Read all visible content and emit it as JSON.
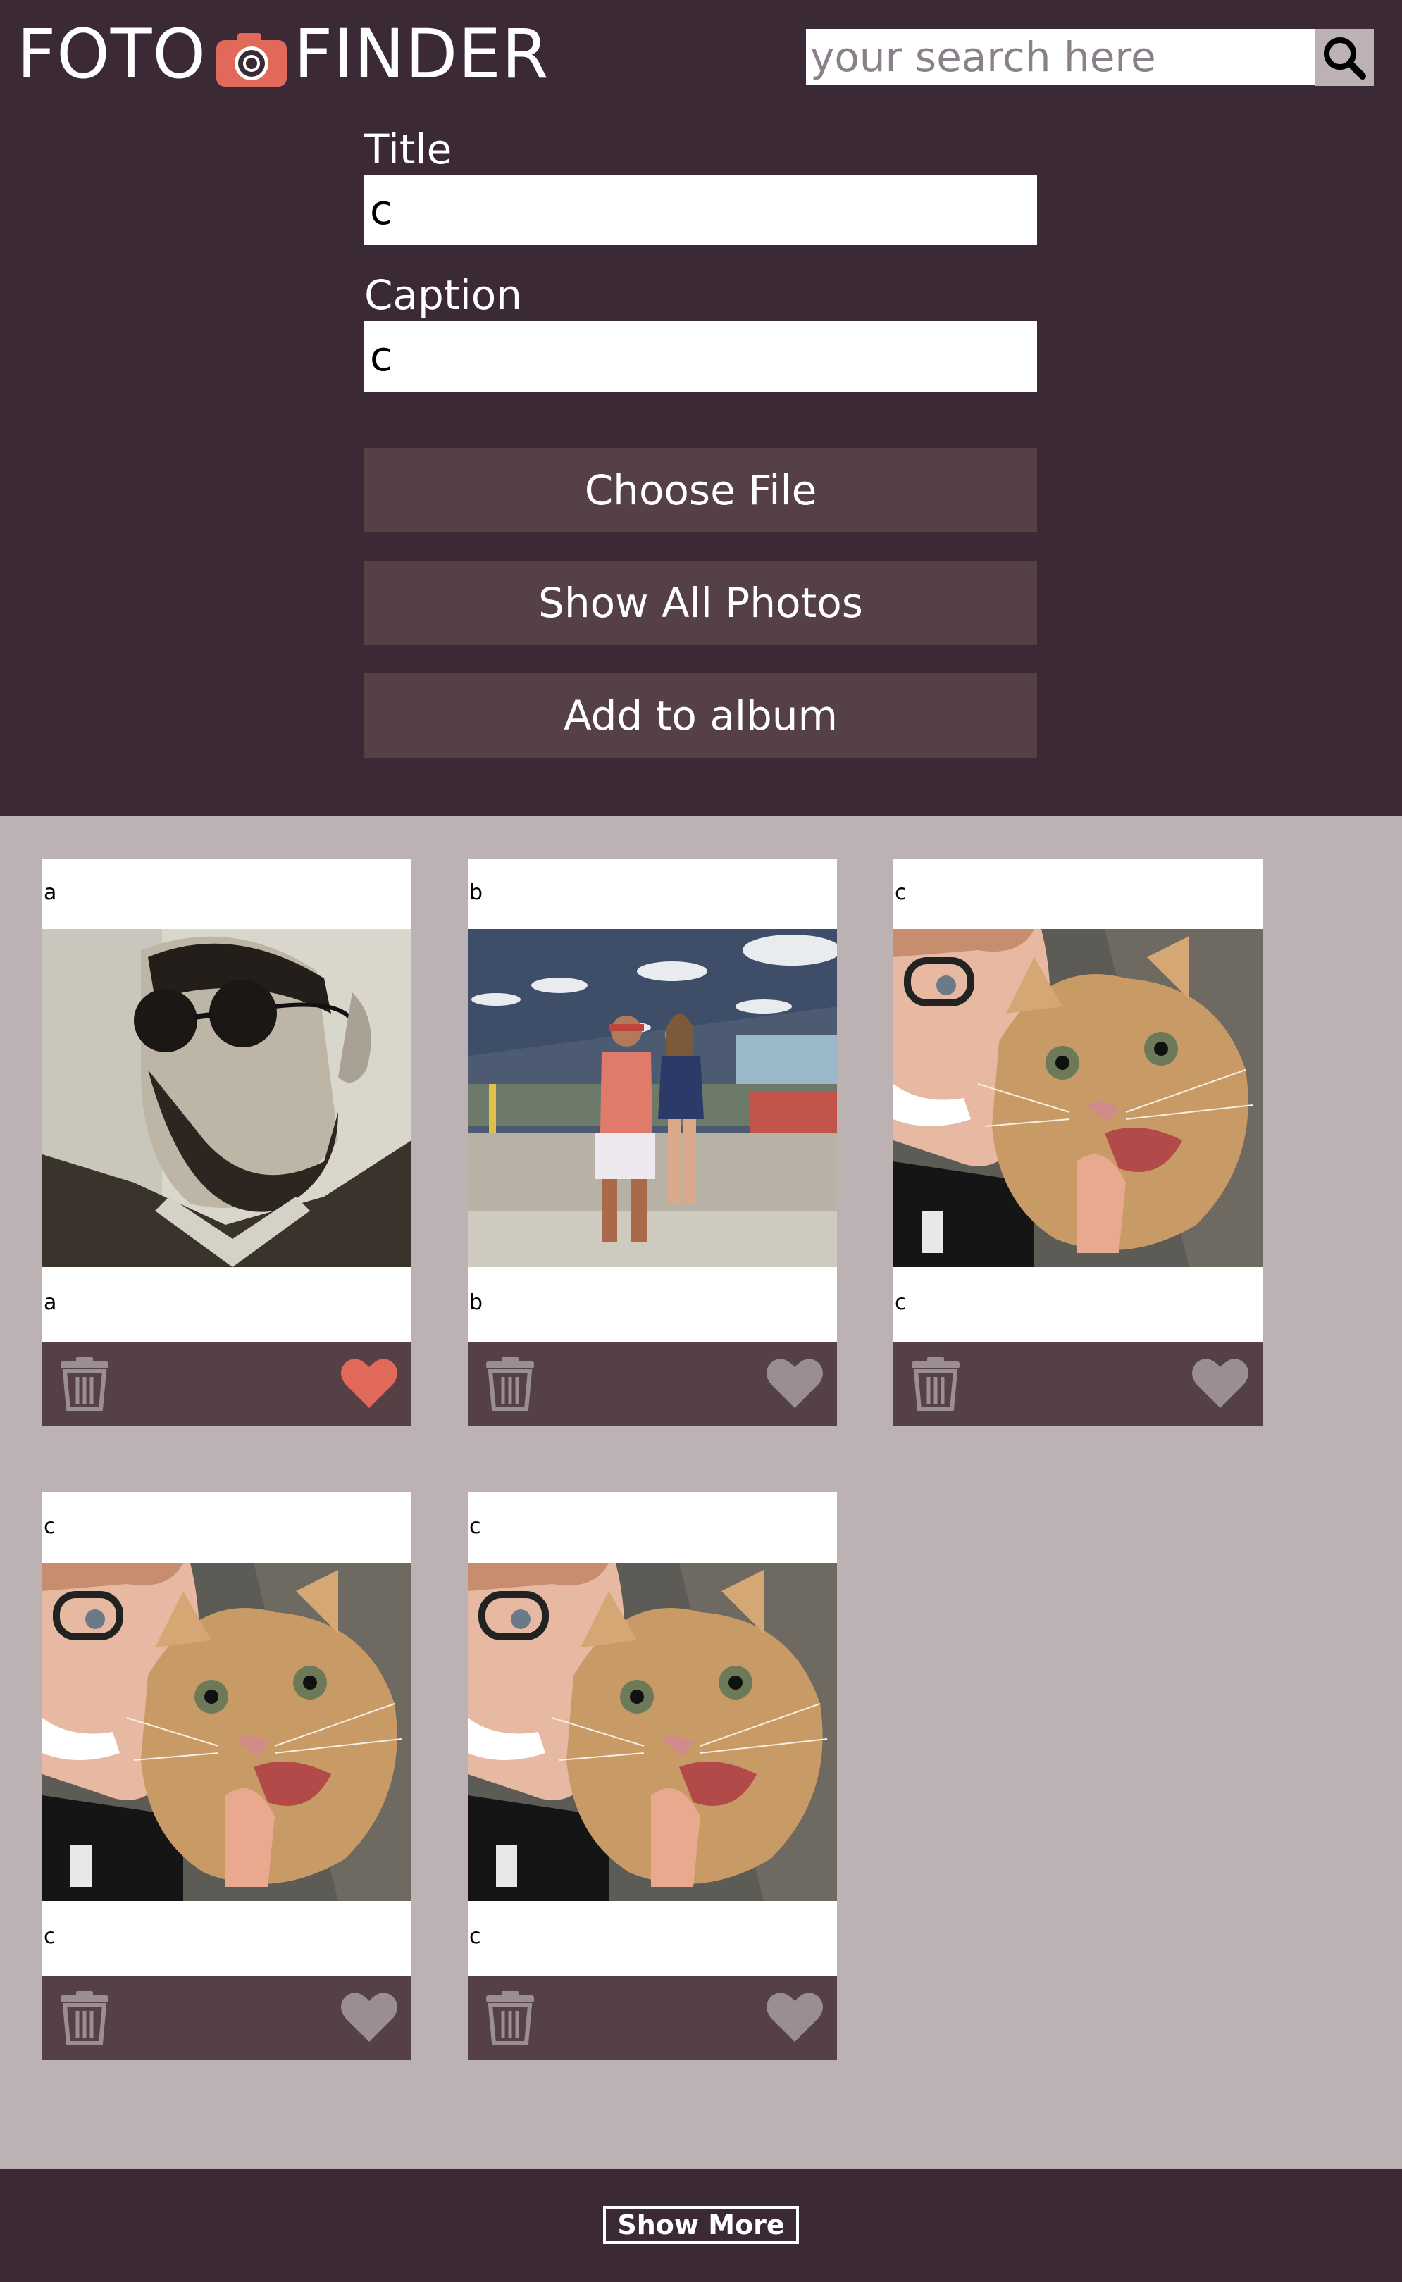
{
  "header": {
    "logo_left": "FOTO",
    "logo_right": "FINDER",
    "logo_icon": "camera-icon",
    "search_placeholder": "your search here",
    "search_icon": "search-icon"
  },
  "form": {
    "title_label": "Title",
    "title_value": "c",
    "caption_label": "Caption",
    "caption_value": "c",
    "choose_file_label": "Choose File",
    "show_all_label": "Show All Photos",
    "add_album_label": "Add to album"
  },
  "cards": [
    {
      "title": "a",
      "caption": "a",
      "photo": "man-with-sunglasses-bw",
      "favorited": true
    },
    {
      "title": "b",
      "caption": "b",
      "photo": "couple-standing-outdoors",
      "favorited": false
    },
    {
      "title": "c",
      "caption": "c",
      "photo": "woman-with-cat",
      "favorited": false
    },
    {
      "title": "c",
      "caption": "c",
      "photo": "woman-with-cat",
      "favorited": false
    },
    {
      "title": "c",
      "caption": "c",
      "photo": "woman-with-cat",
      "favorited": false
    }
  ],
  "card_icons": {
    "delete": "trash-icon",
    "favorite": "heart-icon"
  },
  "footer": {
    "show_more_label": "Show More"
  },
  "colors": {
    "header_bg": "#3b2a35",
    "page_bg": "#bcb1b3",
    "button_bg": "#554045",
    "accent": "#e0695a",
    "icon_muted": "#9a8e91"
  }
}
